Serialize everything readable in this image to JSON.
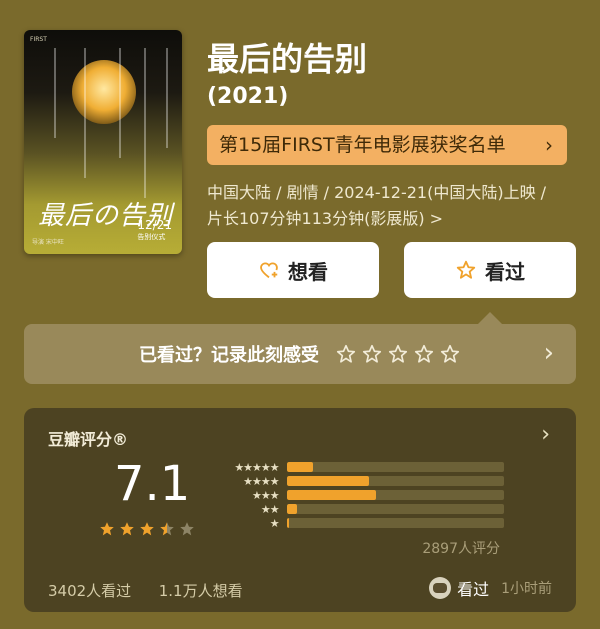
{
  "movie": {
    "title": "最后的告别",
    "year": "(2021)",
    "award_banner": "第15届FIRST青年电影展获奖名单",
    "meta_line1": "中国大陆 / 剧情 / 2024-12-21(中国大陆)上映 /",
    "meta_line2": "片长107分钟113分钟(影展版) >",
    "poster": {
      "signature": "最后の告别",
      "date": "12/21",
      "date_sub": "告别仪式",
      "credits": "导演 宋中旺",
      "top_mark": "FIRST"
    }
  },
  "actions": {
    "want_label": "想看",
    "watched_label": "看过"
  },
  "record": {
    "prompt": "已看过？记录此刻感受",
    "stars_count": 5
  },
  "rating": {
    "header": "豆瓣评分®",
    "score": "7.1",
    "stars_value": 3.5,
    "distribution": [
      {
        "label": "★★★★★",
        "pct": 0.12
      },
      {
        "label": "★★★★",
        "pct": 0.38
      },
      {
        "label": "★★★",
        "pct": 0.41
      },
      {
        "label": "★★",
        "pct": 0.05
      },
      {
        "label": "★",
        "pct": 0.01
      }
    ],
    "count_text": "2897人评分",
    "watched_text": "3402人看过",
    "want_text": "1.1万人想看",
    "user_status": "看过",
    "user_time": "1小时前"
  },
  "colors": {
    "background": "#7a6a2c",
    "accent": "#f0a22c",
    "award_bg": "#f3b062"
  }
}
